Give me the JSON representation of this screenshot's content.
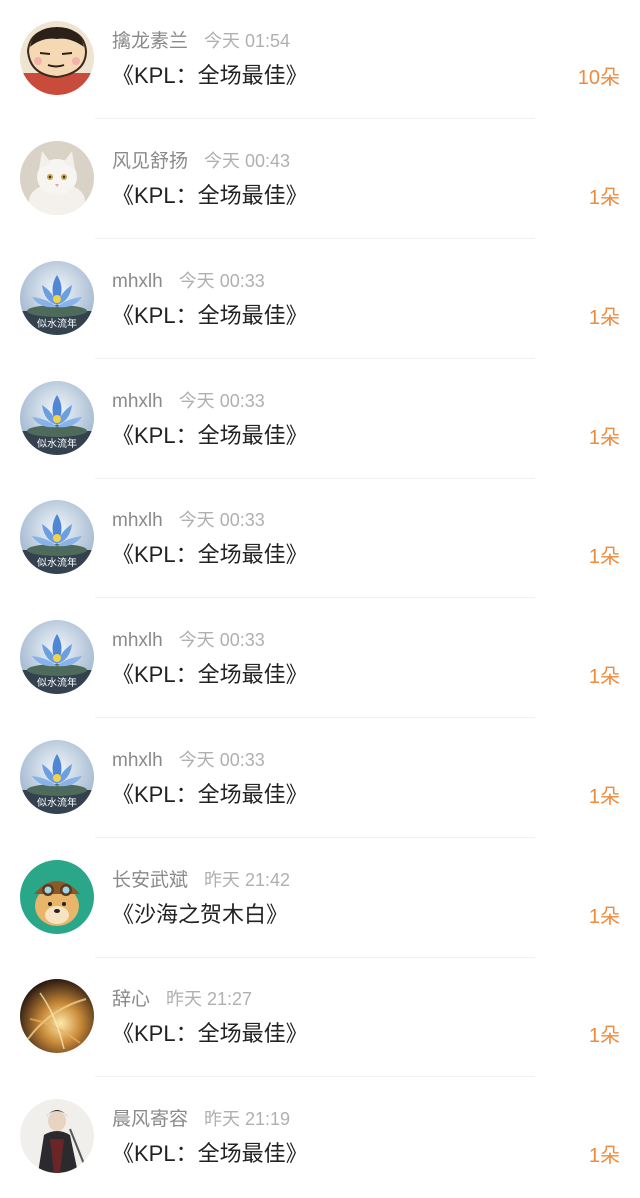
{
  "accent_color": "#f08a3c",
  "items": [
    {
      "name": "擒龙素兰",
      "time": "今天 01:54",
      "title": "《KPL：全场最佳》",
      "count": "10朵",
      "avatar_icon": "cartoon-boy-avatar"
    },
    {
      "name": "风见舒扬",
      "time": "今天 00:43",
      "title": "《KPL：全场最佳》",
      "count": "1朵",
      "avatar_icon": "white-cat-avatar"
    },
    {
      "name": "mhxlh",
      "time": "今天 00:33",
      "title": "《KPL：全场最佳》",
      "count": "1朵",
      "avatar_icon": "lotus-avatar",
      "avatar_text": "似水流年"
    },
    {
      "name": "mhxlh",
      "time": "今天 00:33",
      "title": "《KPL：全场最佳》",
      "count": "1朵",
      "avatar_icon": "lotus-avatar",
      "avatar_text": "似水流年"
    },
    {
      "name": "mhxlh",
      "time": "今天 00:33",
      "title": "《KPL：全场最佳》",
      "count": "1朵",
      "avatar_icon": "lotus-avatar",
      "avatar_text": "似水流年"
    },
    {
      "name": "mhxlh",
      "time": "今天 00:33",
      "title": "《KPL：全场最佳》",
      "count": "1朵",
      "avatar_icon": "lotus-avatar",
      "avatar_text": "似水流年"
    },
    {
      "name": "mhxlh",
      "time": "今天 00:33",
      "title": "《KPL：全场最佳》",
      "count": "1朵",
      "avatar_icon": "lotus-avatar",
      "avatar_text": "似水流年"
    },
    {
      "name": "长安武斌",
      "time": "昨天 21:42",
      "title": "《沙海之贺木白》",
      "count": "1朵",
      "avatar_icon": "doge-pilot-avatar"
    },
    {
      "name": "辞心",
      "time": "昨天 21:27",
      "title": "《KPL：全场最佳》",
      "count": "1朵",
      "avatar_icon": "golden-light-avatar"
    },
    {
      "name": "晨风寄容",
      "time": "昨天 21:19",
      "title": "《KPL：全场最佳》",
      "count": "1朵",
      "avatar_icon": "ink-warrior-avatar"
    }
  ]
}
